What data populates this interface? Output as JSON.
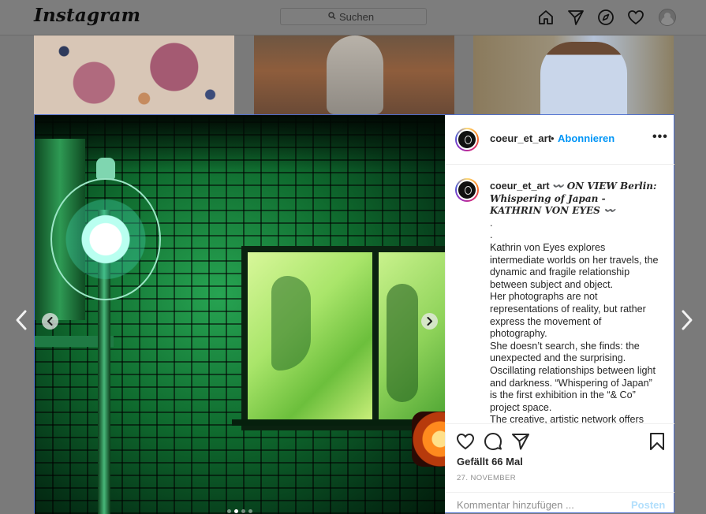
{
  "app": {
    "logo_text": "Instagram"
  },
  "search": {
    "placeholder": "Suchen"
  },
  "nav_icons": [
    "home-icon",
    "direct-icon",
    "explore-icon",
    "activity-heart-icon",
    "profile-avatar"
  ],
  "post": {
    "username": "coeur_et_art",
    "separator": "•",
    "follow_label": "Abonnieren",
    "more_label": "•••",
    "caption": {
      "username": "coeur_et_art",
      "title_line": "〰️ ON VIEW Berlin: Whispering of Japan - KATHRIN VON EYES 〰️",
      "lines": [
        ".",
        ".",
        "Kathrin von Eyes explores intermediate worlds on her travels, the dynamic and fragile relationship between subject and object.",
        "Her photographs are not representations of reality, but rather express the movement of photography.",
        "She doesn’t search, she finds: the unexpected and the surprising. Oscillating relationships between light and darkness. “Whispering of Japan” is the first exhibition in the “& Co” project space.",
        "The creative, artistic network offers"
      ]
    },
    "likes_text": "Gefällt 66 Mal",
    "date_text": "27. NOVEMBER",
    "comment_placeholder": "Kommentar hinzufügen ...",
    "post_label": "Posten",
    "carousel": {
      "slide_count": 4,
      "active_index": 1
    }
  },
  "colors": {
    "accent": "#0095f6",
    "post_disabled": "#b2dffc",
    "overlay": "#7a7a7a"
  }
}
